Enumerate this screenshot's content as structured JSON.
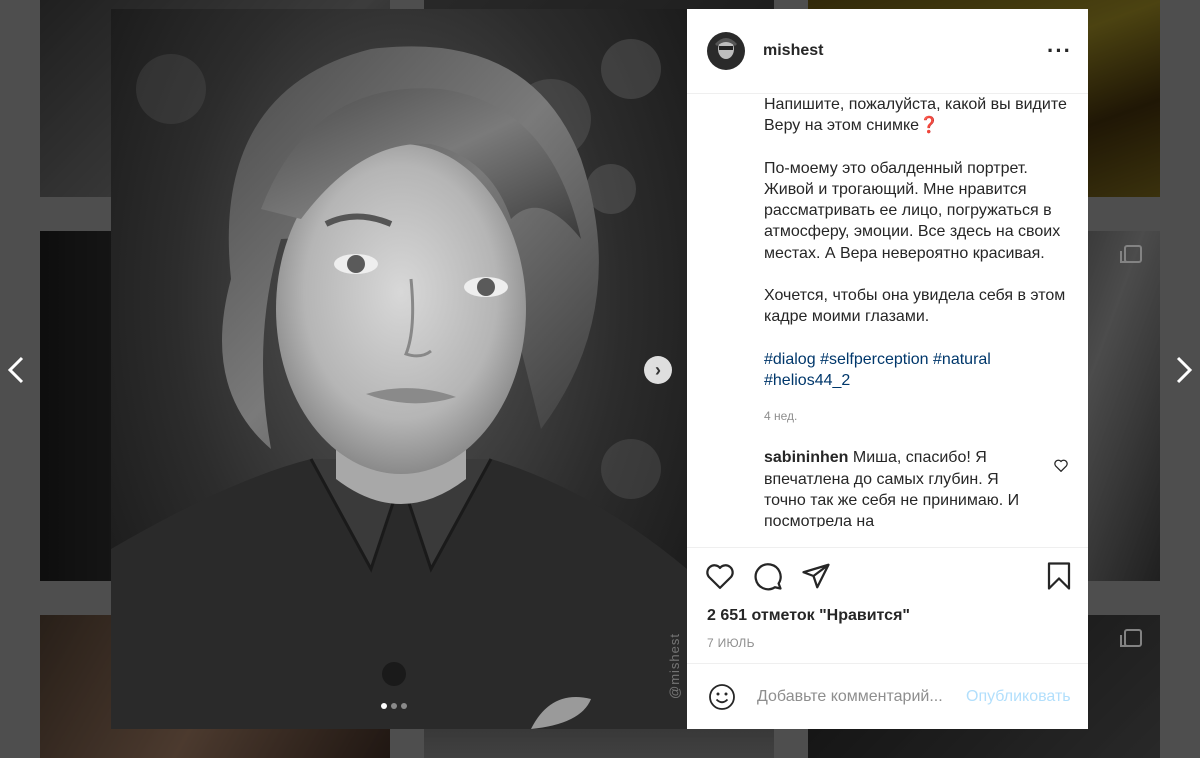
{
  "post": {
    "username": "mishest",
    "more_icon": "more-horizontal-icon",
    "photo_watermark": "@mishest",
    "carousel": {
      "count": 3,
      "active": 1
    },
    "caption_paragraphs": [
      "Напишите, пожалуйста, какой вы видите Веру на этом снимке❓",
      "По-моему это обалденный портрет. Живой и трогающий. Мне нравится рассматривать ее лицо, погружаться в атмосферу, эмоции. Все здесь на своих местах. А Вера невероятно красивая.",
      "Хочется, чтобы она увидела себя в этом кадре моими глазами."
    ],
    "hashtags": [
      "#dialog",
      "#selfperception",
      "#natural",
      "#helios44_2"
    ],
    "time_ago": "4 нед.",
    "likes": "2 651 отметок \"Нравится\"",
    "date": "7 ИЮЛЬ"
  },
  "comments": [
    {
      "username": "sabininhen",
      "text": "Миша, спасибо! Я впечатлена до самых глубин. Я точно так же себя не принимаю. И посмотрела на"
    }
  ],
  "composer": {
    "placeholder": "Добавьте комментарий...",
    "publish_label": "Опубликовать"
  },
  "colors": {
    "hashtag": "#00376b",
    "publish_disabled": "#b2dffc",
    "secondary_text": "#8e8e8e"
  },
  "icons": [
    "heart-icon",
    "comment-icon",
    "share-icon",
    "bookmark-icon",
    "emoji-icon",
    "chevron-left-icon",
    "chevron-right-icon",
    "multiple-posts-icon"
  ]
}
